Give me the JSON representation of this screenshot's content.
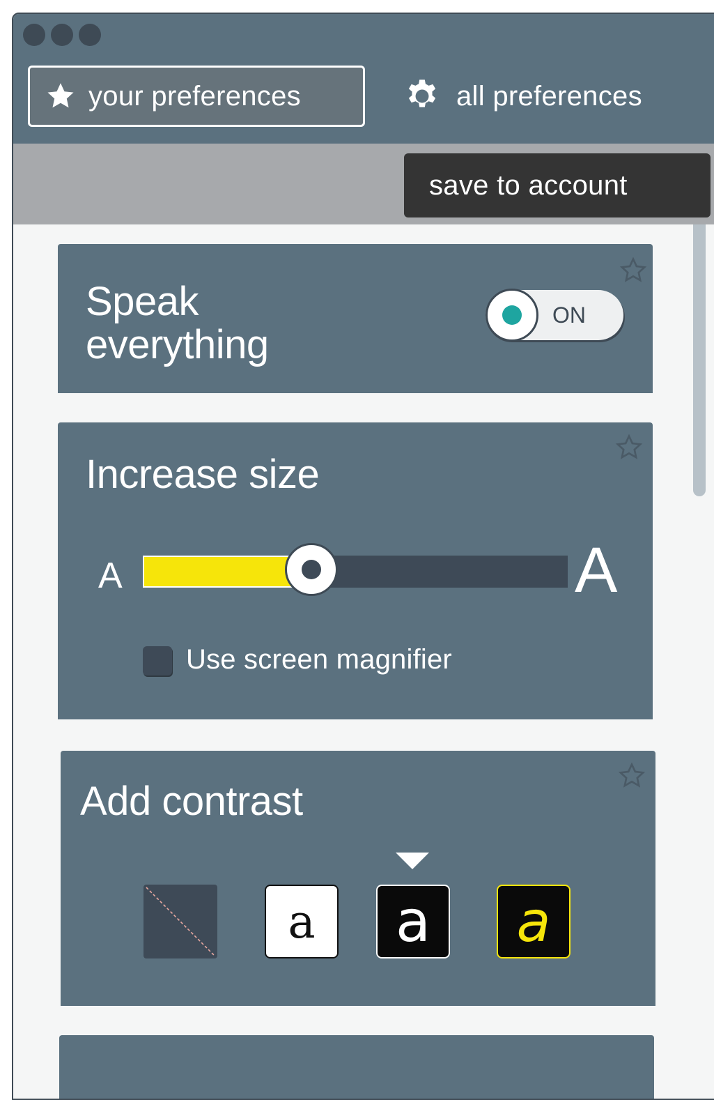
{
  "window": {
    "controls": [
      "close-dot",
      "minimize-dot",
      "maximize-dot"
    ]
  },
  "tabs": {
    "your_preferences": {
      "label": "your preferences",
      "icon": "star-icon",
      "active": true
    },
    "all_preferences": {
      "label": "all preferences",
      "icon": "gear-icon",
      "active": false
    }
  },
  "toolbar": {
    "save_label": "save to account"
  },
  "cards": {
    "speak": {
      "title_line1": "Speak",
      "title_line2": "everything",
      "toggle_state": "ON",
      "favorite_icon": "star-outline-icon"
    },
    "size": {
      "title": "Increase size",
      "small_label": "A",
      "large_label": "A",
      "slider_value_fraction": 0.38,
      "magnifier_label": "Use screen magnifier",
      "magnifier_checked": false,
      "favorite_icon": "star-outline-icon"
    },
    "contrast": {
      "title": "Add contrast",
      "options": [
        {
          "id": "none",
          "glyph": ""
        },
        {
          "id": "black-on-white",
          "glyph": "a"
        },
        {
          "id": "white-on-black",
          "glyph": "a"
        },
        {
          "id": "yellow-on-black",
          "glyph": "a"
        }
      ],
      "selected_index": 2,
      "favorite_icon": "star-outline-icon"
    }
  },
  "colors": {
    "panel": "#5b717f",
    "toolbar": "#a7a9ac",
    "accent_yellow": "#f6e50a",
    "toggle_teal": "#1ea5a0",
    "dark": "#343434"
  }
}
